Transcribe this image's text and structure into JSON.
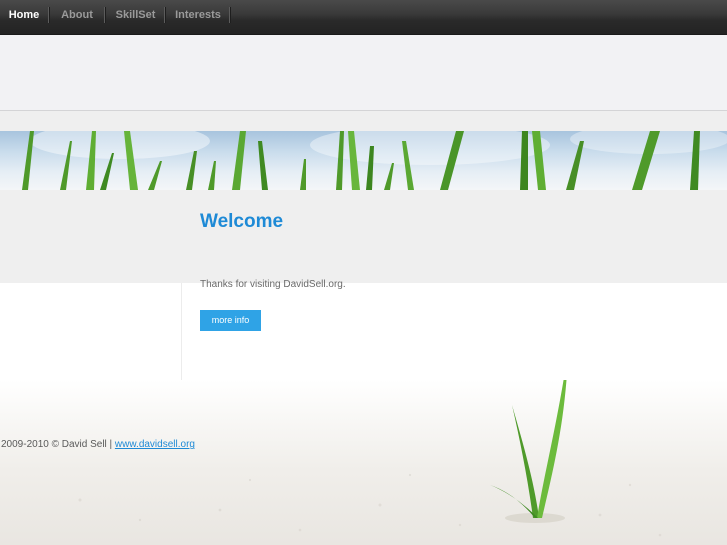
{
  "nav": {
    "items": [
      {
        "label": "Home",
        "active": true
      },
      {
        "label": "About",
        "active": false
      },
      {
        "label": "SkillSet",
        "active": false
      },
      {
        "label": "Interests",
        "active": false
      }
    ]
  },
  "main": {
    "title": "Welcome",
    "intro": "Thanks for visiting DavidSell.org.",
    "button_label": "more info"
  },
  "footer": {
    "text": "2009-2010 © David Sell | ",
    "link_text": "www.davidsell.org"
  },
  "colors": {
    "accent": "#1e8ad6",
    "button": "#2fa3e6",
    "nav_bg": "#2e2e2e"
  }
}
